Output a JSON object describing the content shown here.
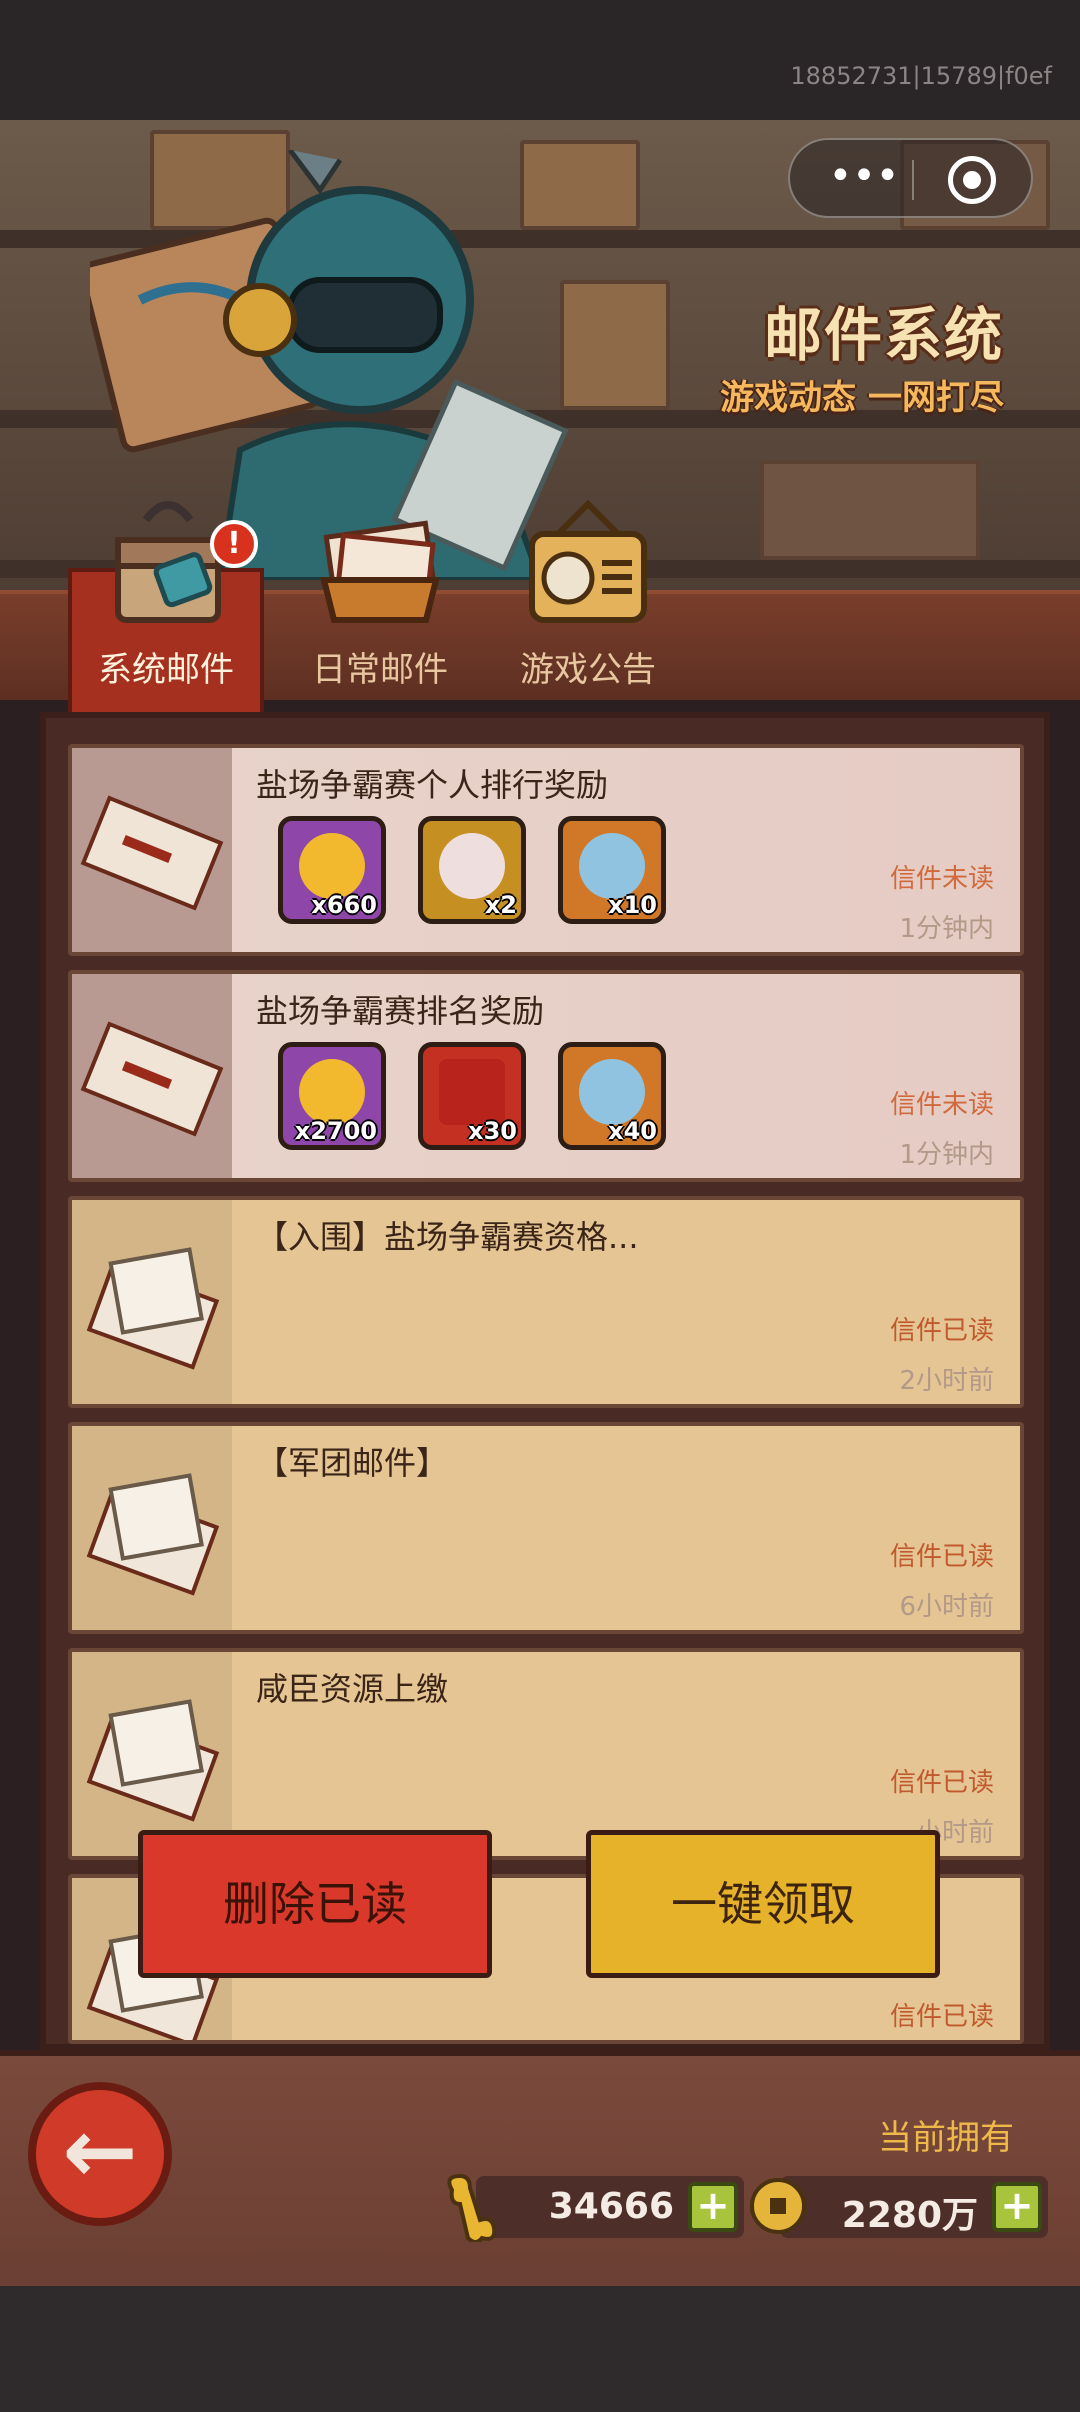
{
  "debug_id": "18852731|15789|f0ef",
  "banner": {
    "title": "邮件系统",
    "subtitle": "游戏动态 一网打尽"
  },
  "capsule": {
    "more_icon": "more-dots-icon",
    "close_icon": "target-icon"
  },
  "tabs": [
    {
      "label": "系统邮件",
      "active": true,
      "badge": "!"
    },
    {
      "label": "日常邮件",
      "active": false
    },
    {
      "label": "游戏公告",
      "active": false
    }
  ],
  "mails": [
    {
      "title": "盐场争霸赛个人排行奖励",
      "status": "信件未读",
      "time": "1分钟内",
      "rewards": [
        {
          "icon": "gold-coin-icon",
          "count": "x660"
        },
        {
          "icon": "pearl-icon",
          "count": "x2"
        },
        {
          "icon": "blue-bowl-icon",
          "count": "x10"
        }
      ]
    },
    {
      "title": "盐场争霸赛排名奖励",
      "status": "信件未读",
      "time": "1分钟内",
      "rewards": [
        {
          "icon": "gold-coin-icon",
          "count": "x2700"
        },
        {
          "icon": "red-chest-icon",
          "count": "x30"
        },
        {
          "icon": "blue-bowl-icon",
          "count": "x40"
        }
      ]
    },
    {
      "title": "【入围】盐场争霸赛资格...",
      "status": "信件已读",
      "time": "2小时前"
    },
    {
      "title": "【军团邮件】",
      "status": "信件已读",
      "time": "6小时前"
    },
    {
      "title": "咸臣资源上缴",
      "status": "信件已读",
      "time": "小时前"
    },
    {
      "title": "",
      "status": "信件已读",
      "time": ""
    }
  ],
  "buttons": {
    "delete_read": "删除已读",
    "claim_all": "一键领取"
  },
  "bottom": {
    "own_label": "当前拥有",
    "resource1": {
      "icon": "bone-icon",
      "value": "34666",
      "plus": "+"
    },
    "resource2": {
      "icon": "copper-coin-icon",
      "value": "2280万",
      "plus": "+"
    }
  },
  "colors": {
    "accent_red": "#d9382a",
    "accent_gold": "#e6b229",
    "unread_status": "#d06a3c"
  }
}
